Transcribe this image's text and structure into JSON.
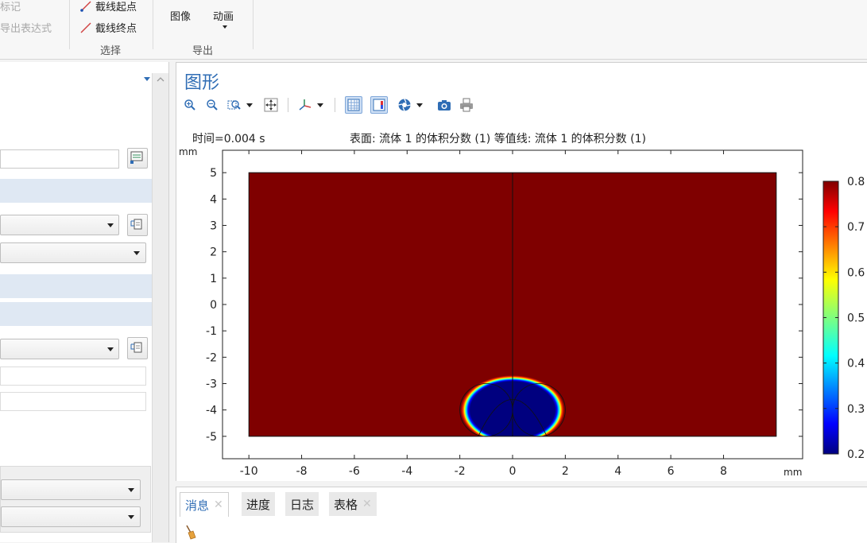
{
  "ribbon": {
    "mark_label": "标记",
    "export_expression_label": "导出表达式",
    "cutline_start_label": "截线起点",
    "cutline_end_label": "截线终点",
    "select_group_label": "选择",
    "image_label": "图像",
    "animation_label": "动画",
    "export_group_label": "导出"
  },
  "graphics": {
    "title": "图形",
    "time_label": "时间=0.004 s",
    "plot_title": "表面: 流体 1 的体积分数 (1)  等值线: 流体 1 的体积分数 (1)",
    "y_unit": "mm",
    "x_unit": "mm"
  },
  "chart_data": {
    "type": "heatmap",
    "title": "表面: 流体 1 的体积分数 (1)  等值线: 流体 1 的体积分数 (1)",
    "subtitle": "时间=0.004 s",
    "xlabel": "mm",
    "ylabel": "mm",
    "xlim": [
      -11,
      11
    ],
    "ylim": [
      -5.85,
      5.85
    ],
    "x_ticks": [
      -10,
      -8,
      -6,
      -4,
      -2,
      0,
      2,
      4,
      6,
      8
    ],
    "y_ticks": [
      5,
      4,
      3,
      2,
      1,
      0,
      -1,
      -2,
      -3,
      -4,
      -5
    ],
    "domain": {
      "x": [
        -10,
        10
      ],
      "y": [
        -5,
        5
      ]
    },
    "divider_x": 0,
    "background_value": 0.8,
    "bubble": {
      "center_x": 0,
      "center_y": -4,
      "half_width": 2,
      "top_y": -2.75,
      "bottom_y": -5,
      "min_value": 0.2
    },
    "colorbar": {
      "min": 0.2,
      "max": 0.8,
      "ticks": [
        0.8,
        0.7,
        0.6,
        0.5,
        0.4,
        0.3,
        0.2
      ],
      "colormap": "jet"
    }
  },
  "bottom_tabs": [
    {
      "label": "消息",
      "closable": true
    },
    {
      "label": "进度",
      "closable": false
    },
    {
      "label": "日志",
      "closable": false
    },
    {
      "label": "表格",
      "closable": true
    }
  ],
  "colors": {
    "accent": "#2f6db5",
    "dark_red": "#7f0000",
    "dark_blue": "#00007f"
  }
}
